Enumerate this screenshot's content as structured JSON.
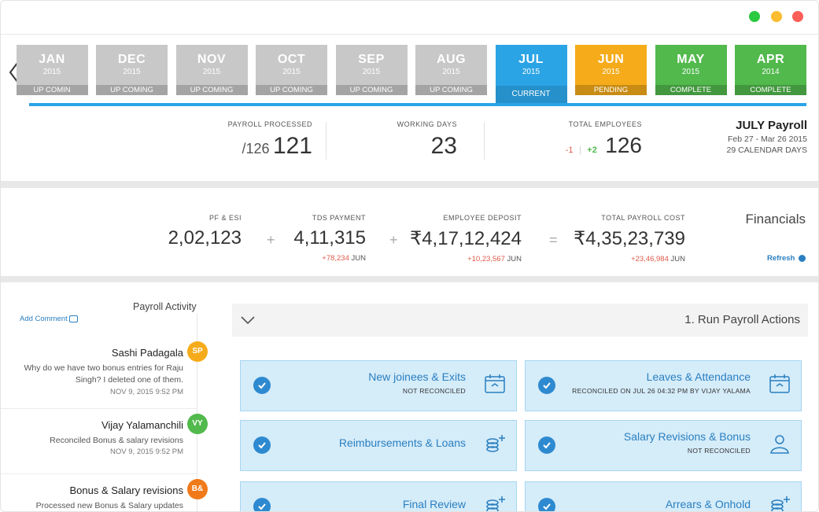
{
  "window": {
    "dot_colors": [
      "#2bc940",
      "#fbbd2e",
      "#fc5f57"
    ]
  },
  "months": [
    {
      "name": "APR",
      "year": "2014",
      "status": "COMPLETE",
      "color": "#52b94d"
    },
    {
      "name": "MAY",
      "year": "2015",
      "status": "COMPLETE",
      "color": "#52b94d"
    },
    {
      "name": "JUN",
      "year": "2015",
      "status": "PENDING",
      "color": "#f5ab1a"
    },
    {
      "name": "JUL",
      "year": "2015",
      "status": "CURRENT",
      "color": "#2ba4e6"
    },
    {
      "name": "AUG",
      "year": "2015",
      "status": "UP COMING",
      "color": "#c8c8c8"
    },
    {
      "name": "SEP",
      "year": "2015",
      "status": "UP COMING",
      "color": "#c8c8c8"
    },
    {
      "name": "OCT",
      "year": "2015",
      "status": "UP COMING",
      "color": "#c8c8c8"
    },
    {
      "name": "NOV",
      "year": "2015",
      "status": "UP COMING",
      "color": "#c8c8c8"
    },
    {
      "name": "DEC",
      "year": "2015",
      "status": "UP COMING",
      "color": "#c8c8c8"
    },
    {
      "name": "JAN",
      "year": "2015",
      "status": "UP COMIN",
      "color": "#c8c8c8"
    }
  ],
  "summary": {
    "title": "JULY Payroll",
    "date_range": "Feb 27 - Mar 26 2015",
    "calendar_days": "29 CALENDAR DAYS",
    "total_employees_label": "TOTAL EMPLOYEES",
    "total_employees_value": "126",
    "employees_added": "+2",
    "employees_removed": "-1",
    "working_days_label": "WORKING DAYS",
    "working_days_value": "23",
    "payroll_processed_label": "PAYROLL PROCESSED",
    "payroll_processed_value": "121",
    "payroll_processed_total": "/126"
  },
  "financials": {
    "title": "Financials",
    "refresh_label": "Refresh",
    "total_cost_label": "TOTAL PAYROLL COST",
    "total_cost_value": "₹4,35,23,739",
    "total_cost_month": "JUN",
    "total_cost_change": "+23,46,984",
    "equals": "=",
    "deposit_label": "EMPLOYEE DEPOSIT",
    "deposit_value": "₹4,17,12,424",
    "deposit_month": "JUN",
    "deposit_change": "+10,23,567",
    "plus1": "+",
    "tds_label": "TDS PAYMENT",
    "tds_value": "4,11,315",
    "tds_month": "JUN",
    "tds_change": "+78,234",
    "plus2": "+",
    "pf_label": "PF & ESI",
    "pf_value": "2,02,123"
  },
  "activity": {
    "title": "Payroll Activity",
    "add_comment": "Add Comment",
    "items": [
      {
        "initials": "SP",
        "color": "#f5ab1a",
        "name": "Sashi Padagala",
        "text": "Why do we have two bonus entries for Raju Singh? I deleted one of them.",
        "time": "NOV 9, 2015 9:52 PM"
      },
      {
        "initials": "VY",
        "color": "#52b94d",
        "name": "Vijay Yalamanchili",
        "text": "Reconciled Bonus & salary revisions",
        "time": "NOV 9, 2015 9:52 PM"
      },
      {
        "initials": "B&",
        "color": "#f07a1a",
        "name": "Bonus & Salary revisions",
        "text": "Processed new Bonus & Salary updates",
        "time": ""
      }
    ]
  },
  "actions": {
    "section_title": "1. Run Payroll Actions",
    "cards": [
      {
        "title": "Leaves & Attendance",
        "sub": "RECONCILED ON JUL 26 04:32 PM BY VIJAY YALAMA",
        "icon": "calendar-icon"
      },
      {
        "title": "New joinees & Exits",
        "sub": "NOT RECONCILED",
        "icon": "calendar-icon"
      },
      {
        "title": "Salary Revisions & Bonus",
        "sub": "NOT RECONCILED",
        "icon": "person-icon"
      },
      {
        "title": "Reimbursements & Loans",
        "sub": "",
        "icon": "coins-icon"
      },
      {
        "title": "Arrears & Onhold",
        "sub": "",
        "icon": "coins-icon"
      },
      {
        "title": "Final Review",
        "sub": "",
        "icon": "coins-icon"
      }
    ]
  }
}
